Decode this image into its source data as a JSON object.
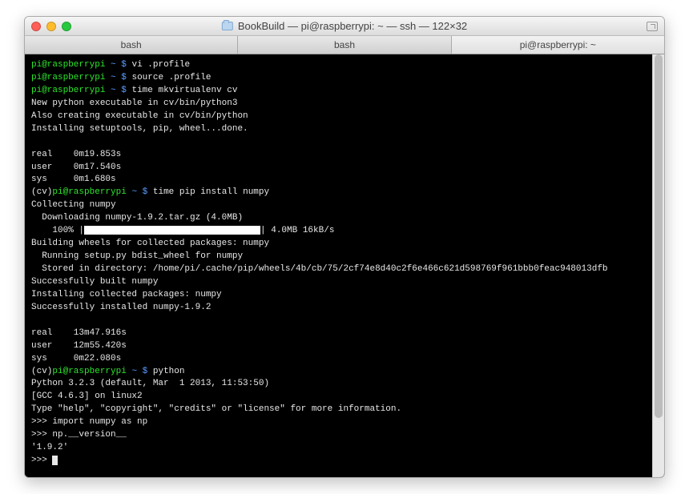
{
  "titlebar": {
    "title": "BookBuild — pi@raspberrypi: ~ — ssh — 122×32"
  },
  "tabs": [
    {
      "label": "bash"
    },
    {
      "label": "bash"
    },
    {
      "label": "pi@raspberrypi: ~"
    }
  ],
  "prompt": {
    "user_host": "pi@raspberrypi",
    "path": "~",
    "symbol": "$",
    "venv": "(cv)"
  },
  "commands": {
    "cmd1": "vi .profile",
    "cmd2": "source .profile",
    "cmd3": "time mkvirtualenv cv",
    "cmd4": "time pip install numpy",
    "cmd5": "python"
  },
  "output": {
    "mkvenv1": "New python executable in cv/bin/python3",
    "mkvenv2": "Also creating executable in cv/bin/python",
    "mkvenv3": "Installing setuptools, pip, wheel...done.",
    "t1_real": "real    0m19.853s",
    "t1_user": "user    0m17.540s",
    "t1_sys": "sys     0m1.680s",
    "pip1": "Collecting numpy",
    "pip2": "  Downloading numpy-1.9.2.tar.gz (4.0MB)",
    "pip_pct": "    100% |",
    "pip_rate": "| 4.0MB 16kB/s",
    "pip3": "Building wheels for collected packages: numpy",
    "pip4": "  Running setup.py bdist_wheel for numpy",
    "pip5": "  Stored in directory: /home/pi/.cache/pip/wheels/4b/cb/75/2cf74e8d40c2f6e466c621d598769f961bbb0feac948013dfb",
    "pip6": "Successfully built numpy",
    "pip7": "Installing collected packages: numpy",
    "pip8": "Successfully installed numpy-1.9.2",
    "t2_real": "real    13m47.916s",
    "t2_user": "user    12m55.420s",
    "t2_sys": "sys     0m22.080s",
    "py1": "Python 3.2.3 (default, Mar  1 2013, 11:53:50)",
    "py2": "[GCC 4.6.3] on linux2",
    "py3": "Type \"help\", \"copyright\", \"credits\" or \"license\" for more information.",
    "repl_prompt": ">>> ",
    "repl1": "import numpy as np",
    "repl2": "np.__version__",
    "repl_out": "'1.9.2'"
  }
}
